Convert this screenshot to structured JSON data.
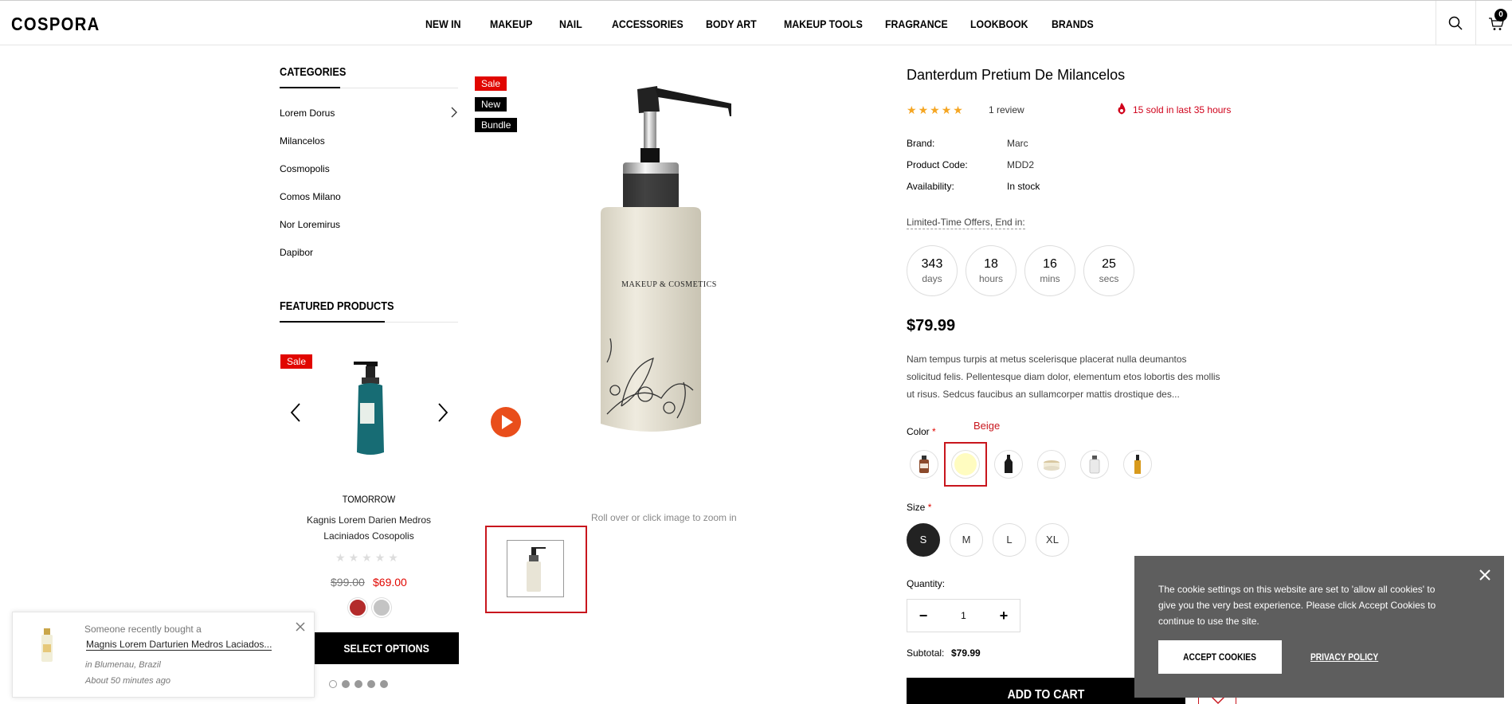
{
  "header": {
    "logo": "COSPORA",
    "nav": [
      "NEW IN",
      "MAKEUP",
      "NAIL",
      "ACCESSORIES",
      "BODY ART",
      "MAKEUP TOOLS",
      "FRAGRANCE",
      "LOOKBOOK",
      "BRANDS"
    ],
    "cart_count": "0"
  },
  "sidebar": {
    "categories_title": "CATEGORIES",
    "categories": [
      "Lorem Dorus",
      "Milancelos",
      "Cosmopolis",
      "Comos Milano",
      "Nor Loremirus",
      "Dapibor"
    ],
    "featured_title": "FEATURED PRODUCTS",
    "featured": {
      "badge": "Sale",
      "vendor": "TOMORROW",
      "name_line1": "Kagnis Lorem Darien Medros",
      "name_line2": "Laciniados Cosopolis",
      "old_price": "$99.00",
      "price": "$69.00",
      "swatch_colors": [
        "#b32b2b",
        "#c4c4c4"
      ],
      "button": "SELECT OPTIONS"
    }
  },
  "gallery": {
    "badges": [
      "Sale",
      "New",
      "Bundle"
    ],
    "bottle_label": "MAKEUP & COSMETICS",
    "zoom_hint": "Roll over or click image to zoom in"
  },
  "product": {
    "title": "Danterdum Pretium De Milancelos",
    "rating": 5,
    "reviews": "1 review",
    "sold": "15 sold in last 35 hours",
    "brand_label": "Brand:",
    "brand": "Marc",
    "code_label": "Product Code:",
    "code": "MDD2",
    "availability_label": "Availability:",
    "availability": "In stock",
    "offer": "Limited-Time Offers, End in:",
    "countdown": [
      {
        "value": "343",
        "unit": "days"
      },
      {
        "value": "18",
        "unit": "hours"
      },
      {
        "value": "16",
        "unit": "mins"
      },
      {
        "value": "25",
        "unit": "secs"
      }
    ],
    "price": "$79.99",
    "desc_line1": "Nam tempus turpis at metus scelerisque placerat nulla deumantos",
    "desc_line2": "solicitud felis. Pellentesque diam dolor, elementum etos lobortis des mollis",
    "desc_line3": "ut risus. Sedcus faucibus an sullamcorper mattis drostique des...",
    "color_label": "Color",
    "required_mark": "*",
    "selected_color": "Beige",
    "size_label": "Size",
    "sizes": [
      "S",
      "M",
      "L",
      "XL"
    ],
    "quantity_label": "Quantity:",
    "quantity": "1",
    "subtotal_label": "Subtotal:",
    "subtotal": "$79.99",
    "add_to_cart": "ADD TO CART"
  },
  "cookie": {
    "line1": "The cookie settings on this website are set to 'allow all cookies' to",
    "line2": "give you the very best experience. Please click Accept Cookies to",
    "line3": "continue to use the site.",
    "accept": "ACCEPT COOKIES",
    "privacy": "PRIVACY POLICY"
  },
  "toast": {
    "line1": "Someone recently bought a",
    "product": "Magnis Lorem Darturien Medros Laciados...",
    "location": "in Blumenau, Brazil",
    "time": "About 50 minutes ago"
  },
  "colors": {
    "accent_red": "#e10600",
    "selected_red": "#c8161d",
    "cookie_bg": "#5e5e5e"
  }
}
